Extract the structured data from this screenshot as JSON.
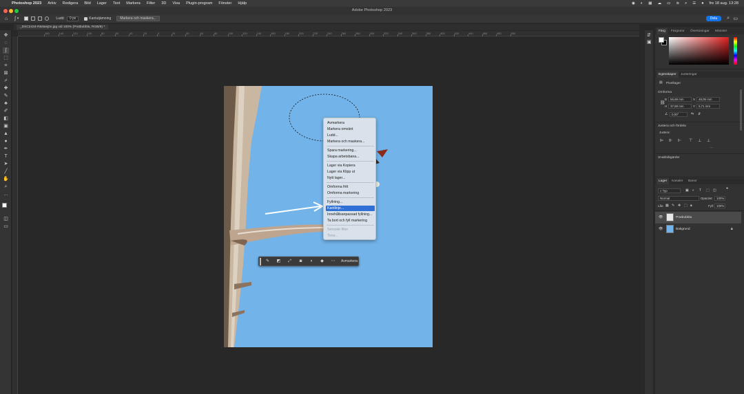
{
  "menubar": {
    "app": "Photoshop 2023",
    "items": [
      "Arkiv",
      "Redigera",
      "Bild",
      "Lager",
      "Text",
      "Markera",
      "Filter",
      "3D",
      "Visa",
      "Plugin-program",
      "Fönster",
      "Hjälp"
    ],
    "datetime": "fre 18 aug. 13:28"
  },
  "titlebar": {
    "title": "Adobe Photoshop 2023"
  },
  "optionsbar": {
    "feather_label": "Ludd:",
    "feather_value": "0 px",
    "antialias_label": "Kantutjämning",
    "select_mask_button": "Markera och maskera...",
    "share_button": "Dela"
  },
  "document": {
    "tab_title": "_DSC2434-Rästasjön.jpg vid 100% (Pratbubbla, RGB/8) *"
  },
  "ruler": {
    "labels": [
      "160",
      "140",
      "120",
      "100",
      "80",
      "60",
      "40",
      "20",
      "0",
      "20",
      "40",
      "60",
      "80",
      "100",
      "120",
      "140",
      "160",
      "180",
      "200",
      "220",
      "240",
      "260",
      "280",
      "300",
      "320",
      "340",
      "360",
      "380",
      "400",
      "420",
      "440",
      "460",
      "480",
      "500"
    ]
  },
  "context_menu": {
    "items": [
      {
        "label": "Avmarkera",
        "state": "normal"
      },
      {
        "label": "Markera omvänt",
        "state": "normal"
      },
      {
        "label": "Ludd...",
        "state": "normal"
      },
      {
        "label": "Markera och maskera...",
        "state": "normal"
      },
      {
        "label": "Spara markering...",
        "state": "normal"
      },
      {
        "label": "Skapa arbetsbana...",
        "state": "normal"
      },
      {
        "label": "Lager via Kopiera",
        "state": "normal"
      },
      {
        "label": "Lager via Klipp ut",
        "state": "normal"
      },
      {
        "label": "Nytt lager...",
        "state": "normal"
      },
      {
        "label": "Omforma fritt",
        "state": "normal"
      },
      {
        "label": "Omforma markering",
        "state": "normal"
      },
      {
        "label": "Fyllning...",
        "state": "normal"
      },
      {
        "label": "Kantlinje...",
        "state": "selected"
      },
      {
        "label": "Innehållsanpassad fyllning...",
        "state": "normal"
      },
      {
        "label": "Ta bort och fyll markering",
        "state": "normal"
      },
      {
        "label": "Senaste filter",
        "state": "disabled"
      },
      {
        "label": "Tona...",
        "state": "disabled"
      }
    ]
  },
  "taskbar": {
    "label": "Avmarkera"
  },
  "color_panel": {
    "tabs": [
      "Färg",
      "Färgrutor",
      "Övertoningar",
      "Mönster"
    ]
  },
  "properties_panel": {
    "tabs": [
      "Egenskaper",
      "Justeringar"
    ],
    "layer_kind": "Pixellager",
    "transform_label": "Omforma",
    "w": "56,69 mm",
    "x": "48,05 mm",
    "h": "37,68 mm",
    "y": "5,71 mm",
    "angle": "0,00°",
    "align_label": "Justera och fördela",
    "align_sub": "Justera:",
    "quick_actions": "Snabbåtgärder"
  },
  "layers_panel": {
    "tabs": [
      "Lager",
      "Kanaler",
      "Banor"
    ],
    "filter": "Typ",
    "blend_mode": "Normal",
    "opacity_label": "Opacitet:",
    "opacity": "100%",
    "lock_label": "Lås:",
    "fill_label": "Fyll:",
    "fill": "100%",
    "layers": [
      {
        "name": "Pratbubbla",
        "selected": true
      },
      {
        "name": "Bakgrund",
        "selected": false
      }
    ]
  },
  "colors": {
    "sky": "#72b4ea",
    "highlight": "#2f6fd6",
    "share": "#1473e6"
  }
}
